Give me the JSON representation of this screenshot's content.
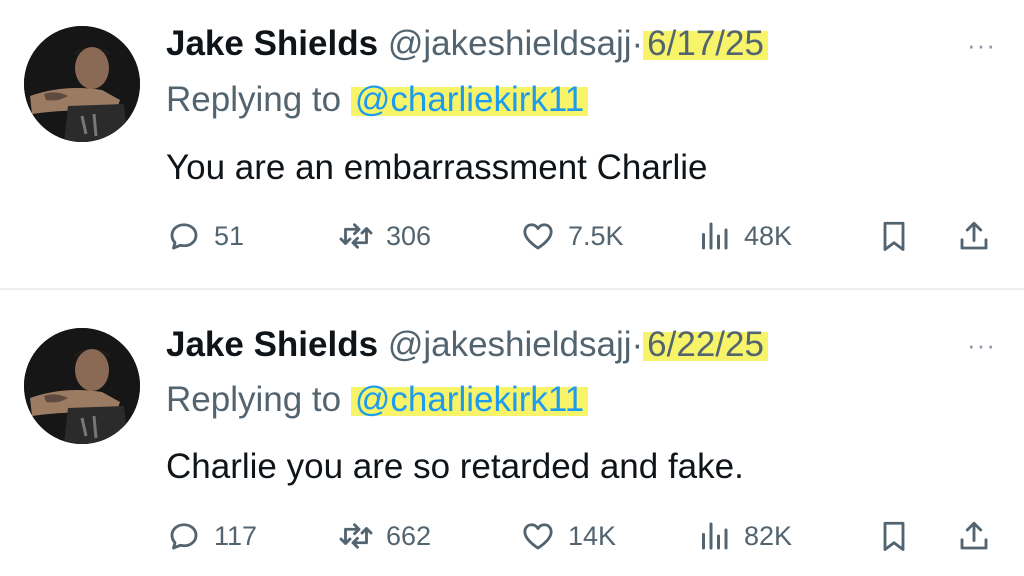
{
  "tweets": [
    {
      "name": "Jake Shields",
      "handle": "@jakeshieldsajj",
      "separator": "·",
      "date": "6/17/25",
      "reply_prefix": "Replying to",
      "reply_to": "@charliekirk11",
      "text": "You are an embarrassment Charlie",
      "replies": "51",
      "retweets": "306",
      "likes": "7.5K",
      "views": "48K"
    },
    {
      "name": "Jake Shields",
      "handle": "@jakeshieldsajj",
      "separator": "·",
      "date": "6/22/25",
      "reply_prefix": "Replying to",
      "reply_to": "@charliekirk11",
      "text": "Charlie you are so retarded and fake.",
      "replies": "117",
      "retweets": "662",
      "likes": "14K",
      "views": "82K"
    }
  ],
  "more_glyph": "···",
  "icons": {
    "reply": "reply-icon",
    "retweet": "retweet-icon",
    "like": "heart-icon",
    "views": "views-icon",
    "bookmark": "bookmark-icon",
    "share": "share-icon"
  },
  "colors": {
    "text": "#0f1419",
    "secondary": "#536471",
    "mention": "#1d9bf0",
    "highlight": "#f7f46a"
  }
}
